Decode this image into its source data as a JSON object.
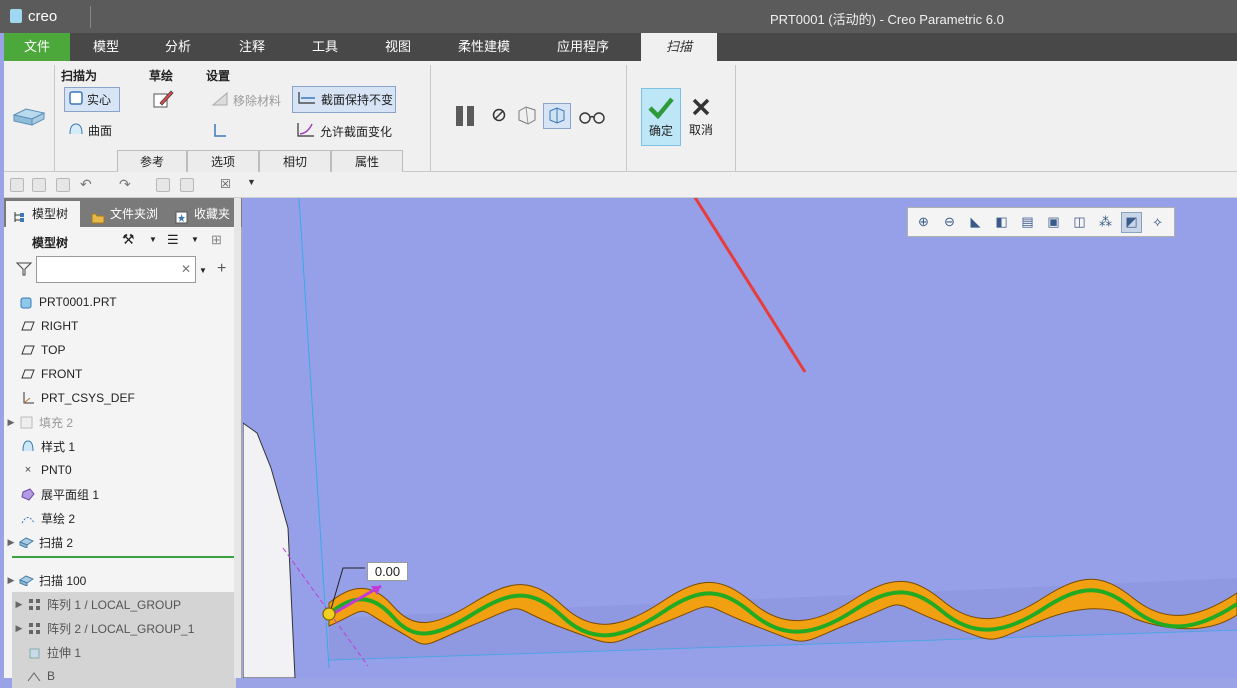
{
  "window": {
    "app_name": "creo",
    "title": "PRT0001 (活动的) - Creo Parametric 6.0"
  },
  "menu": {
    "file": "文件",
    "tabs": [
      "模型",
      "分析",
      "注释",
      "工具",
      "视图",
      "柔性建模",
      "应用程序"
    ],
    "active_tab": "扫描"
  },
  "ribbon": {
    "sweep_as": {
      "label": "扫描为",
      "solid": "实心",
      "surface": "曲面"
    },
    "sketch": {
      "label": "草绘"
    },
    "settings": {
      "label": "设置",
      "remove_material": "移除材料",
      "constant_section": "截面保持不变",
      "variable_section": "允许截面变化"
    },
    "subtabs": [
      "参考",
      "选项",
      "相切",
      "属性"
    ],
    "ok": "确定",
    "cancel": "取消"
  },
  "left_panel": {
    "tabs": [
      "模型树",
      "文件夹浏",
      "收藏夹"
    ],
    "tree_header": "模型树",
    "filter_placeholder": "",
    "items": [
      {
        "label": "PRT0001.PRT",
        "icon": "part-icon"
      },
      {
        "label": "RIGHT",
        "icon": "datum-plane-icon"
      },
      {
        "label": "TOP",
        "icon": "datum-plane-icon"
      },
      {
        "label": "FRONT",
        "icon": "datum-plane-icon"
      },
      {
        "label": "PRT_CSYS_DEF",
        "icon": "csys-icon"
      },
      {
        "label": "填充 2",
        "icon": "fill-icon",
        "dim": true
      },
      {
        "label": "样式 1",
        "icon": "style-icon"
      },
      {
        "label": "PNT0",
        "icon": "point-icon"
      },
      {
        "label": "展平面组 1",
        "icon": "flatten-quilt-icon"
      },
      {
        "label": "草绘 2",
        "icon": "sketch-icon"
      },
      {
        "label": "扫描 2",
        "icon": "sweep-icon"
      },
      {
        "label": "扫描 100",
        "icon": "sweep-icon",
        "insert": true
      },
      {
        "label": "阵列 1 / LOCAL_GROUP",
        "icon": "pattern-icon",
        "suppressed": true
      },
      {
        "label": "阵列 2 / LOCAL_GROUP_1",
        "icon": "pattern-icon",
        "suppressed": true
      },
      {
        "label": "拉伸 1",
        "icon": "extrude-icon",
        "suppressed": true
      },
      {
        "label": "B",
        "icon": "sketch-icon",
        "suppressed": true
      }
    ]
  },
  "viewport": {
    "dimension_value": "0.00",
    "background_color": "#96a0e8",
    "sweep_color": "#f0a010",
    "trajectory_color": "#22aa22",
    "arrow_color": "#e83c3c"
  }
}
